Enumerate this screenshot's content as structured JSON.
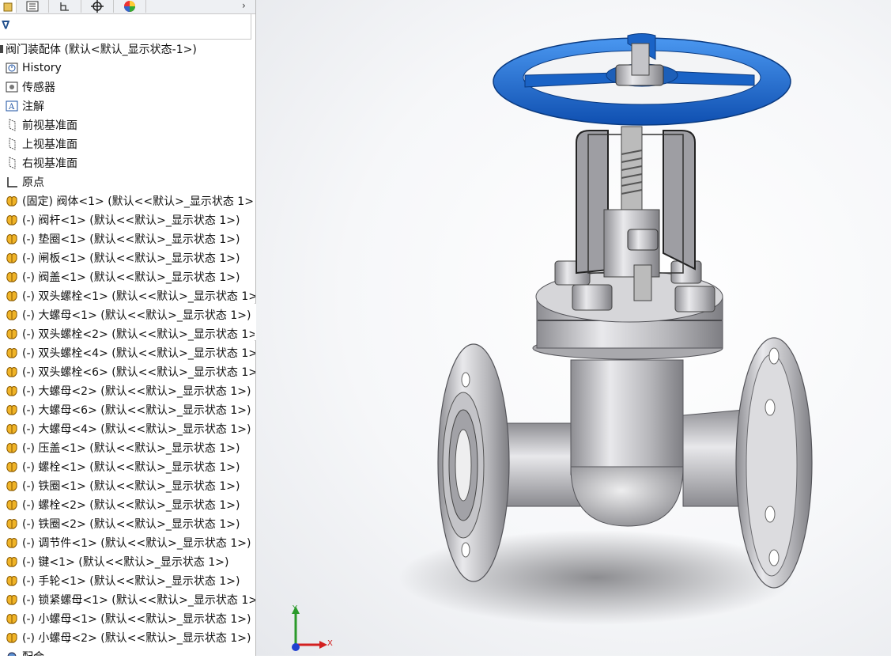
{
  "tabs": [
    {
      "name": "feature-manager-tab",
      "icon": "feature-tree-icon"
    },
    {
      "name": "property-manager-tab",
      "icon": "property-list-icon"
    },
    {
      "name": "configuration-manager-tab",
      "icon": "configuration-icon"
    },
    {
      "name": "dimxpert-tab",
      "icon": "crosshair-icon"
    },
    {
      "name": "display-manager-tab",
      "icon": "color-wheel-icon"
    }
  ],
  "tree": {
    "root": "阀门装配体  (默认<默认_显示状态-1>)",
    "items": [
      {
        "label": "History",
        "icon": "history-icon"
      },
      {
        "label": "传感器",
        "icon": "sensor-icon"
      },
      {
        "label": "注解",
        "icon": "annotation-icon"
      },
      {
        "label": "前视基准面",
        "icon": "plane-icon"
      },
      {
        "label": "上视基准面",
        "icon": "plane-icon"
      },
      {
        "label": "右视基准面",
        "icon": "plane-icon"
      },
      {
        "label": "原点",
        "icon": "origin-icon"
      },
      {
        "label": "(固定) 阀体<1> (默认<<默认>_显示状态 1>",
        "icon": "part-icon"
      },
      {
        "label": "(-) 阀杆<1> (默认<<默认>_显示状态 1>)",
        "icon": "part-icon"
      },
      {
        "label": "(-) 垫圈<1> (默认<<默认>_显示状态 1>)",
        "icon": "part-icon"
      },
      {
        "label": "(-) 闸板<1> (默认<<默认>_显示状态 1>)",
        "icon": "part-icon"
      },
      {
        "label": "(-) 阀盖<1> (默认<<默认>_显示状态 1>)",
        "icon": "part-icon"
      },
      {
        "label": "(-) 双头螺栓<1> (默认<<默认>_显示状态 1>)",
        "icon": "part-icon"
      },
      {
        "label": "(-) 大螺母<1> (默认<<默认>_显示状态 1>)",
        "icon": "part-icon"
      },
      {
        "label": "(-) 双头螺栓<2> (默认<<默认>_显示状态 1>)",
        "icon": "part-icon"
      },
      {
        "label": "(-) 双头螺栓<4> (默认<<默认>_显示状态 1>)",
        "icon": "part-icon"
      },
      {
        "label": "(-) 双头螺栓<6> (默认<<默认>_显示状态 1>)",
        "icon": "part-icon"
      },
      {
        "label": "(-) 大螺母<2> (默认<<默认>_显示状态 1>)",
        "icon": "part-icon"
      },
      {
        "label": "(-) 大螺母<6> (默认<<默认>_显示状态 1>)",
        "icon": "part-icon"
      },
      {
        "label": "(-) 大螺母<4> (默认<<默认>_显示状态 1>)",
        "icon": "part-icon"
      },
      {
        "label": "(-) 压盖<1> (默认<<默认>_显示状态 1>)",
        "icon": "part-icon"
      },
      {
        "label": "(-) 螺栓<1> (默认<<默认>_显示状态 1>)",
        "icon": "part-icon"
      },
      {
        "label": "(-) 铁圈<1> (默认<<默认>_显示状态 1>)",
        "icon": "part-icon"
      },
      {
        "label": "(-) 螺栓<2> (默认<<默认>_显示状态 1>)",
        "icon": "part-icon"
      },
      {
        "label": "(-) 铁圈<2> (默认<<默认>_显示状态 1>)",
        "icon": "part-icon"
      },
      {
        "label": "(-) 调节件<1> (默认<<默认>_显示状态 1>)",
        "icon": "part-icon"
      },
      {
        "label": "(-) 键<1> (默认<<默认>_显示状态 1>)",
        "icon": "part-icon"
      },
      {
        "label": "(-) 手轮<1> (默认<<默认>_显示状态 1>)",
        "icon": "part-icon"
      },
      {
        "label": "(-) 锁紧螺母<1> (默认<<默认>_显示状态 1>)",
        "icon": "part-icon"
      },
      {
        "label": "(-) 小螺母<1> (默认<<默认>_显示状态 1>)",
        "icon": "part-icon"
      },
      {
        "label": "(-) 小螺母<2> (默认<<默认>_显示状态 1>)",
        "icon": "part-icon"
      },
      {
        "label": "配合",
        "icon": "mates-icon"
      }
    ]
  },
  "triad": {
    "x_label": "X",
    "y_label": "Y"
  },
  "colors": {
    "handwheel": "#1f6fd6",
    "steel": "#b9b9bd",
    "axis_x": "#d32020",
    "axis_y": "#2a9a2a",
    "axis_z": "#2040d0"
  }
}
